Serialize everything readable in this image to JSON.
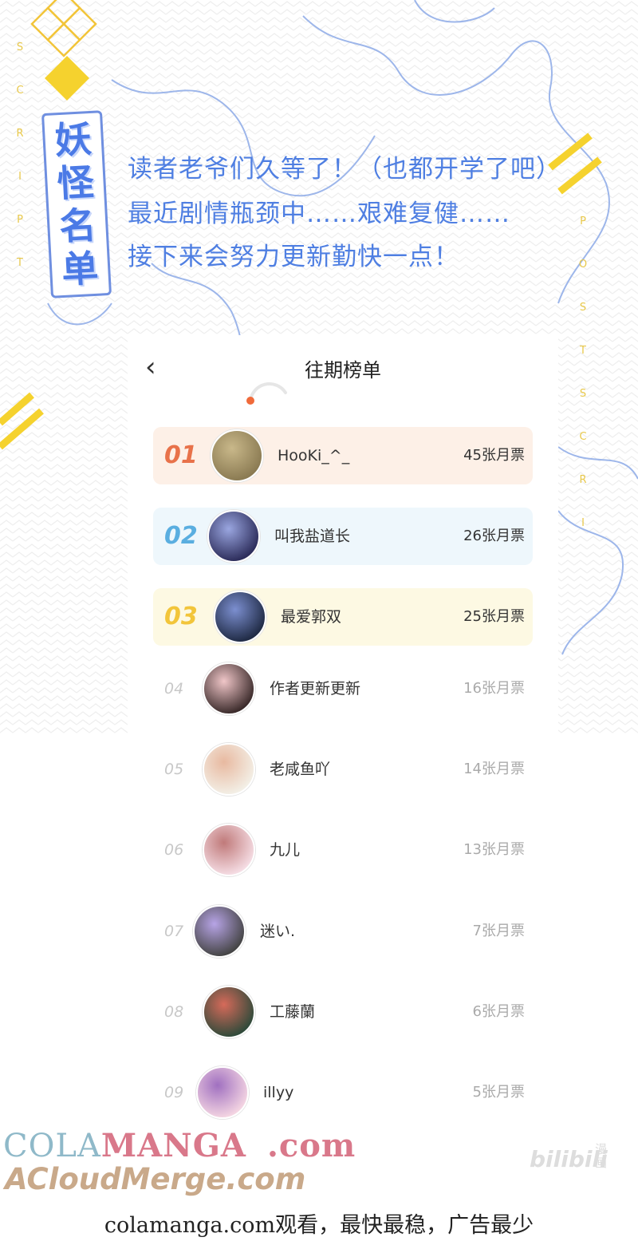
{
  "header": {
    "badge_title": [
      "妖",
      "怪",
      "名",
      "单"
    ],
    "side_left_letters": [
      "S",
      "C",
      "R",
      "I",
      "P",
      "T"
    ],
    "side_right_letters": [
      "P",
      "O",
      "S",
      "T",
      "S",
      "C",
      "R",
      "I"
    ],
    "intro_lines": [
      "读者老爷们久等了！（也都开学了吧）",
      "最近剧情瓶颈中……艰难复健……",
      "接下来会努力更新勤快一点！"
    ]
  },
  "board": {
    "title": "往期榜单",
    "back_icon": "‹",
    "entries": [
      {
        "rank": "01",
        "name": "HooKi_^_",
        "votes": "45张月票",
        "rank_color": "#e8724a",
        "bg": "#fdf0e7"
      },
      {
        "rank": "02",
        "name": "叫我盐道长",
        "votes": "26张月票",
        "rank_color": "#5aaee0",
        "bg": "#eef7fc"
      },
      {
        "rank": "03",
        "name": "最爱郭双",
        "votes": "25张月票",
        "rank_color": "#f2c53a",
        "bg": "#fdf9e3"
      },
      {
        "rank": "04",
        "name": "作者更新更新",
        "votes": "16张月票"
      },
      {
        "rank": "05",
        "name": "老咸鱼吖",
        "votes": "14张月票"
      },
      {
        "rank": "06",
        "name": "九儿",
        "votes": "13张月票"
      },
      {
        "rank": "07",
        "name": "迷い.",
        "votes": "7张月票"
      },
      {
        "rank": "08",
        "name": "工藤蘭",
        "votes": "6张月票"
      },
      {
        "rank": "09",
        "name": "illyy",
        "votes": "5张月票"
      }
    ]
  },
  "watermarks": {
    "cola_part1": "COLA",
    "cola_part2": "MANGA",
    "cola_part3": ".com",
    "cloud": "ACloudMerge.com",
    "bili": "bilibili",
    "bili_small": "漫画"
  },
  "footer": "colamanga.com观看，最快最稳，广告最少",
  "colors": {
    "accent_blue": "#4f7fe2",
    "accent_yellow": "#f2c53a"
  }
}
